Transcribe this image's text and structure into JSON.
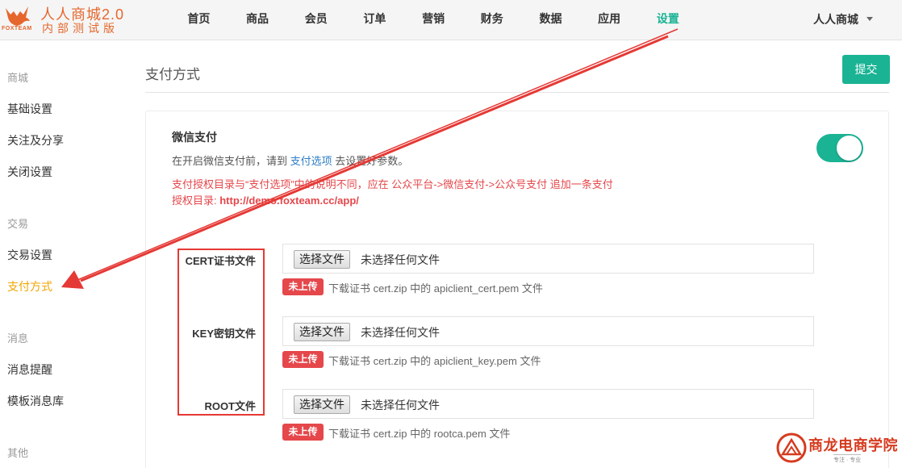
{
  "brand": {
    "title": "人人商城2.0",
    "subtitle": "内部测试版",
    "small": "FOXTEAM",
    "color": "#e5672d"
  },
  "nav": {
    "items": [
      "首页",
      "商品",
      "会员",
      "订单",
      "营销",
      "财务",
      "数据",
      "应用",
      "设置"
    ],
    "active": "设置",
    "user": "人人商城"
  },
  "sidebar": {
    "groups": [
      {
        "label": "商城",
        "items": [
          "基础设置",
          "关注及分享",
          "关闭设置"
        ]
      },
      {
        "label": "交易",
        "items": [
          "交易设置",
          "支付方式"
        ]
      },
      {
        "label": "消息",
        "items": [
          "消息提醒",
          "模板消息库"
        ]
      },
      {
        "label": "其他"
      }
    ],
    "active": "支付方式"
  },
  "main": {
    "title": "支付方式",
    "submit": "提交",
    "wechat": {
      "title": "微信支付",
      "desc_before": "在开启微信支付前，请到 ",
      "desc_link": "支付选项",
      "desc_after": " 去设置好参数。",
      "note_line1": "支付授权目录与“支付选项”中的说明不同，应在 公众平台->微信支付->公众号支付 追加一条支付",
      "note_line2_prefix": "授权目录: ",
      "note_line2_url": "http://demo.foxteam.cc/app/",
      "enabled": true
    },
    "files": [
      {
        "label": "CERT证书文件",
        "button": "选择文件",
        "status": "未选择任何文件",
        "badge": "未上传",
        "help": "下载证书 cert.zip 中的 apiclient_cert.pem 文件"
      },
      {
        "label": "KEY密钥文件",
        "button": "选择文件",
        "status": "未选择任何文件",
        "badge": "未上传",
        "help": "下载证书 cert.zip 中的 apiclient_key.pem 文件"
      },
      {
        "label": "ROOT文件",
        "button": "选择文件",
        "status": "未选择任何文件",
        "badge": "未上传",
        "help": "下载证书 cert.zip 中的 rootca.pem 文件"
      }
    ]
  },
  "watermark": {
    "text": "商龙电商学院",
    "sub": "专注 · 专业"
  },
  "colors": {
    "accent": "#1ab394",
    "active_sidebar": "#f0a500",
    "danger": "#e5474b",
    "link": "#2e7dc5"
  }
}
